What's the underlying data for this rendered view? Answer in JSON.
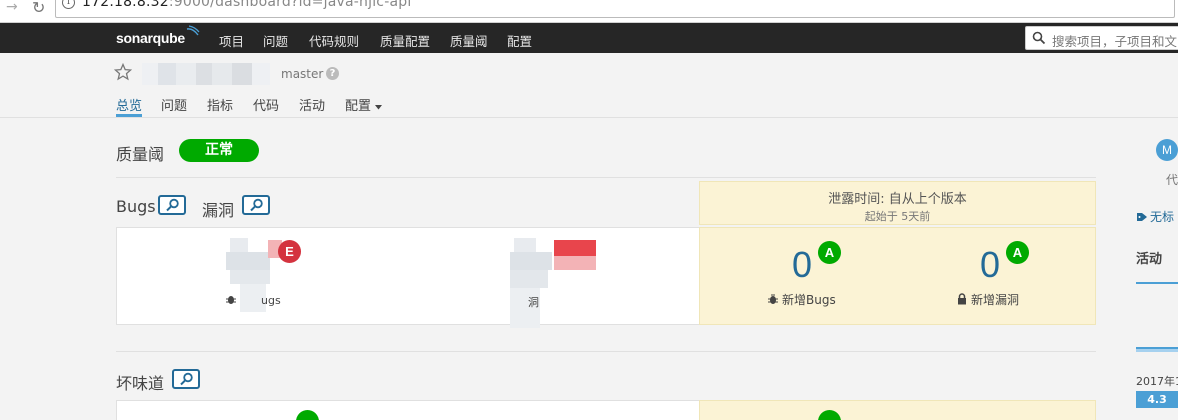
{
  "browser": {
    "url_host": "172.18.8.32",
    "url_rest": ":9000/dashboard?id=java-hjlc-api"
  },
  "navbar": {
    "logo": "sonarqube",
    "items": [
      "项目",
      "问题",
      "代码规则",
      "质量配置",
      "质量阈",
      "配置"
    ],
    "search_placeholder": "搜索项目，子项目和文"
  },
  "project": {
    "branch": "master",
    "tabs": [
      "总览",
      "问题",
      "指标",
      "代码",
      "活动",
      "配置"
    ]
  },
  "quality_gate": {
    "label": "质量阈",
    "status": "正常"
  },
  "leak": {
    "title": "泄露时间: 自从上个版本",
    "subtitle": "起始于 5天前"
  },
  "sections": {
    "bugs_title": "Bugs",
    "vuln_title": "漏洞",
    "smells_title": "坏味道"
  },
  "metrics": {
    "bugs_rating": "E",
    "bugs_label_partial": "ugs",
    "vuln_label_partial": "洞",
    "new_bugs_value": "0",
    "new_bugs_rating": "A",
    "new_bugs_label": "新增Bugs",
    "new_vuln_value": "0",
    "new_vuln_rating": "A",
    "new_vuln_label": "新增漏洞"
  },
  "sidebar": {
    "avatar_letter": "M",
    "text_partial": "代",
    "tag_partial": "无标",
    "activity": "活动",
    "date_partial": "2017年1",
    "version": "4.3"
  },
  "colors": {
    "navbar_bg": "#262626",
    "quality_gate_ok": "#00aa00",
    "rating_e": "#d4333f",
    "rating_a": "#00aa00",
    "link_blue": "#236a97",
    "leak_bg": "#fbf3d5"
  }
}
